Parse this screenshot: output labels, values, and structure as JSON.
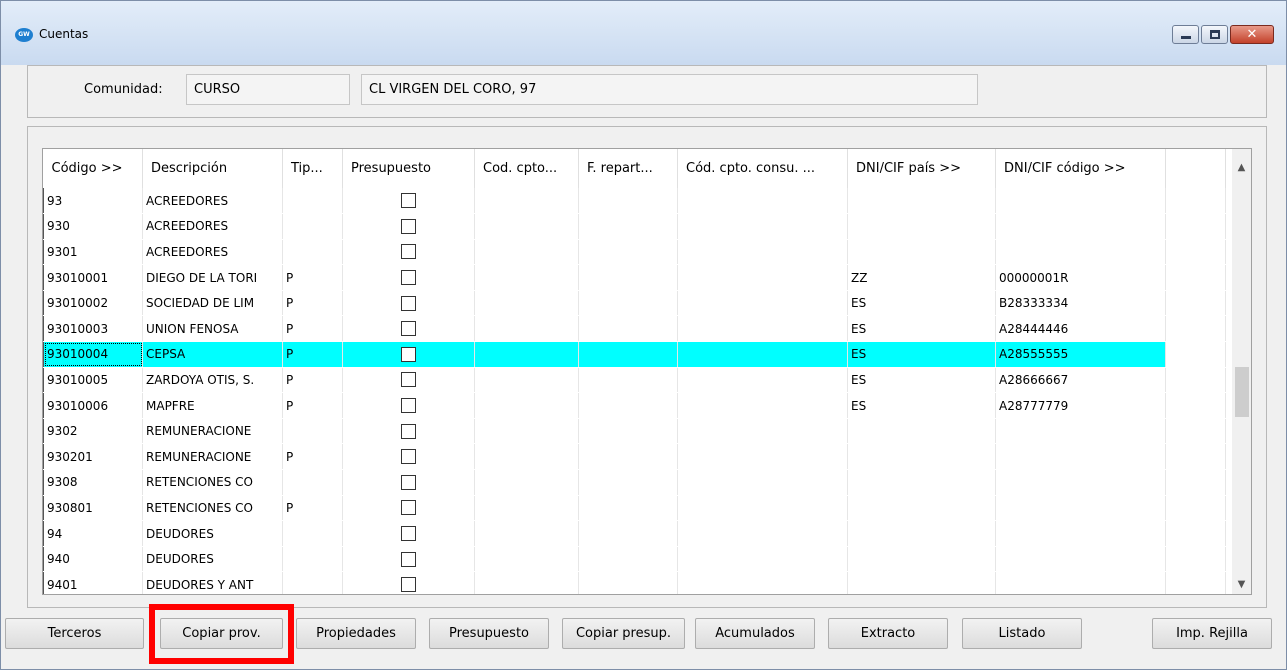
{
  "window": {
    "title": "Cuentas",
    "app_icon": "app-logo-icon"
  },
  "header": {
    "comunidad_label": "Comunidad:",
    "comunidad_code": "CURSO",
    "comunidad_address": "CL VIRGEN DEL CORO, 97"
  },
  "grid": {
    "columns": [
      "Código >>",
      "Descripción",
      "Tip...",
      "Presupuesto",
      "Cod. cpto...",
      "F. repart...",
      "Cód. cpto. consu. ...",
      "DNI/CIF país >>",
      "DNI/CIF código >>"
    ],
    "rows": [
      {
        "codigo": "93",
        "descripcion": "ACREEDORES",
        "tipo": "",
        "pais": "",
        "cif": ""
      },
      {
        "codigo": "930",
        "descripcion": "ACREEDORES",
        "tipo": "",
        "pais": "",
        "cif": ""
      },
      {
        "codigo": "9301",
        "descripcion": "ACREEDORES",
        "tipo": "",
        "pais": "",
        "cif": ""
      },
      {
        "codigo": "93010001",
        "descripcion": "DIEGO DE LA TORI",
        "tipo": "P",
        "pais": "ZZ",
        "cif": "00000001R"
      },
      {
        "codigo": "93010002",
        "descripcion": "SOCIEDAD DE LIM",
        "tipo": "P",
        "pais": "ES",
        "cif": "B28333334"
      },
      {
        "codigo": "93010003",
        "descripcion": "UNION FENOSA",
        "tipo": "P",
        "pais": "ES",
        "cif": "A28444446"
      },
      {
        "codigo": "93010004",
        "descripcion": "CEPSA",
        "tipo": "P",
        "pais": "ES",
        "cif": "A28555555"
      },
      {
        "codigo": "93010005",
        "descripcion": "ZARDOYA OTIS, S.",
        "tipo": "P",
        "pais": "ES",
        "cif": "A28666667"
      },
      {
        "codigo": "93010006",
        "descripcion": "MAPFRE",
        "tipo": "P",
        "pais": "ES",
        "cif": "A28777779"
      },
      {
        "codigo": "9302",
        "descripcion": "REMUNERACIONE",
        "tipo": "",
        "pais": "",
        "cif": ""
      },
      {
        "codigo": "930201",
        "descripcion": "REMUNERACIONE",
        "tipo": "P",
        "pais": "",
        "cif": ""
      },
      {
        "codigo": "9308",
        "descripcion": "RETENCIONES CO",
        "tipo": "",
        "pais": "",
        "cif": ""
      },
      {
        "codigo": "930801",
        "descripcion": "RETENCIONES CO",
        "tipo": "P",
        "pais": "",
        "cif": ""
      },
      {
        "codigo": "94",
        "descripcion": "DEUDORES",
        "tipo": "",
        "pais": "",
        "cif": ""
      },
      {
        "codigo": "940",
        "descripcion": "DEUDORES",
        "tipo": "",
        "pais": "",
        "cif": ""
      },
      {
        "codigo": "9401",
        "descripcion": "DEUDORES Y ANT",
        "tipo": "",
        "pais": "",
        "cif": ""
      }
    ],
    "selected_row_index": 6,
    "selection_color": "#00ffff"
  },
  "buttons": {
    "terceros": "Terceros",
    "copiar_prov": "Copiar prov.",
    "propiedades": "Propiedades",
    "presupuesto": "Presupuesto",
    "copiar_presup": "Copiar presup.",
    "acumulados": "Acumulados",
    "extracto": "Extracto",
    "listado": "Listado",
    "imp_rejilla": "Imp. Rejilla"
  },
  "highlight_color": "#ff0000"
}
